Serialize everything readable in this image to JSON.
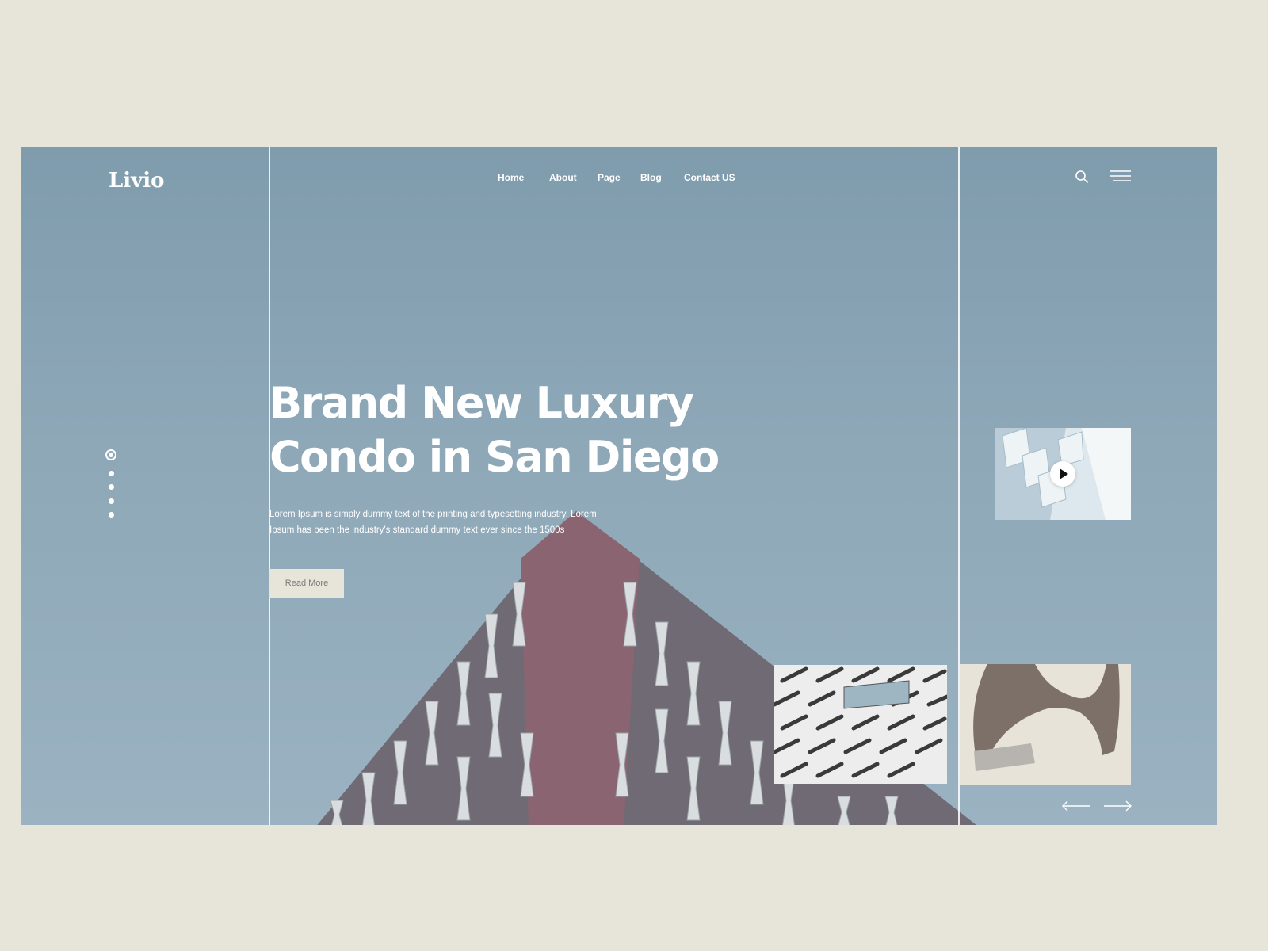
{
  "brand": {
    "logo": "Livio"
  },
  "nav": {
    "items": [
      {
        "label": "Home"
      },
      {
        "label": "About"
      },
      {
        "label": "Page"
      },
      {
        "label": "Blog"
      },
      {
        "label": "Contact US"
      }
    ]
  },
  "header_icons": [
    "search-icon",
    "hamburger-menu-icon"
  ],
  "hero": {
    "title_line1": "Brand New Luxury",
    "title_line2": "Condo in San Diego",
    "description": "Lorem Ipsum is simply dummy text of the printing and typesetting industry. Lorem Ipsum has been the industry's standard dummy text ever since the 1500s",
    "button_label": "Read More"
  },
  "slider": {
    "slide_count": 5,
    "active_index": 0
  },
  "side_icons": [
    "play-icon",
    "arrow-left-icon",
    "arrow-right-icon"
  ],
  "colors": {
    "page_background": "#e7e4d9",
    "hero_sky": "#8ea8b8",
    "text": "#ffffff",
    "button_background": "#e7e4d9",
    "button_text": "#7a7a7a"
  }
}
